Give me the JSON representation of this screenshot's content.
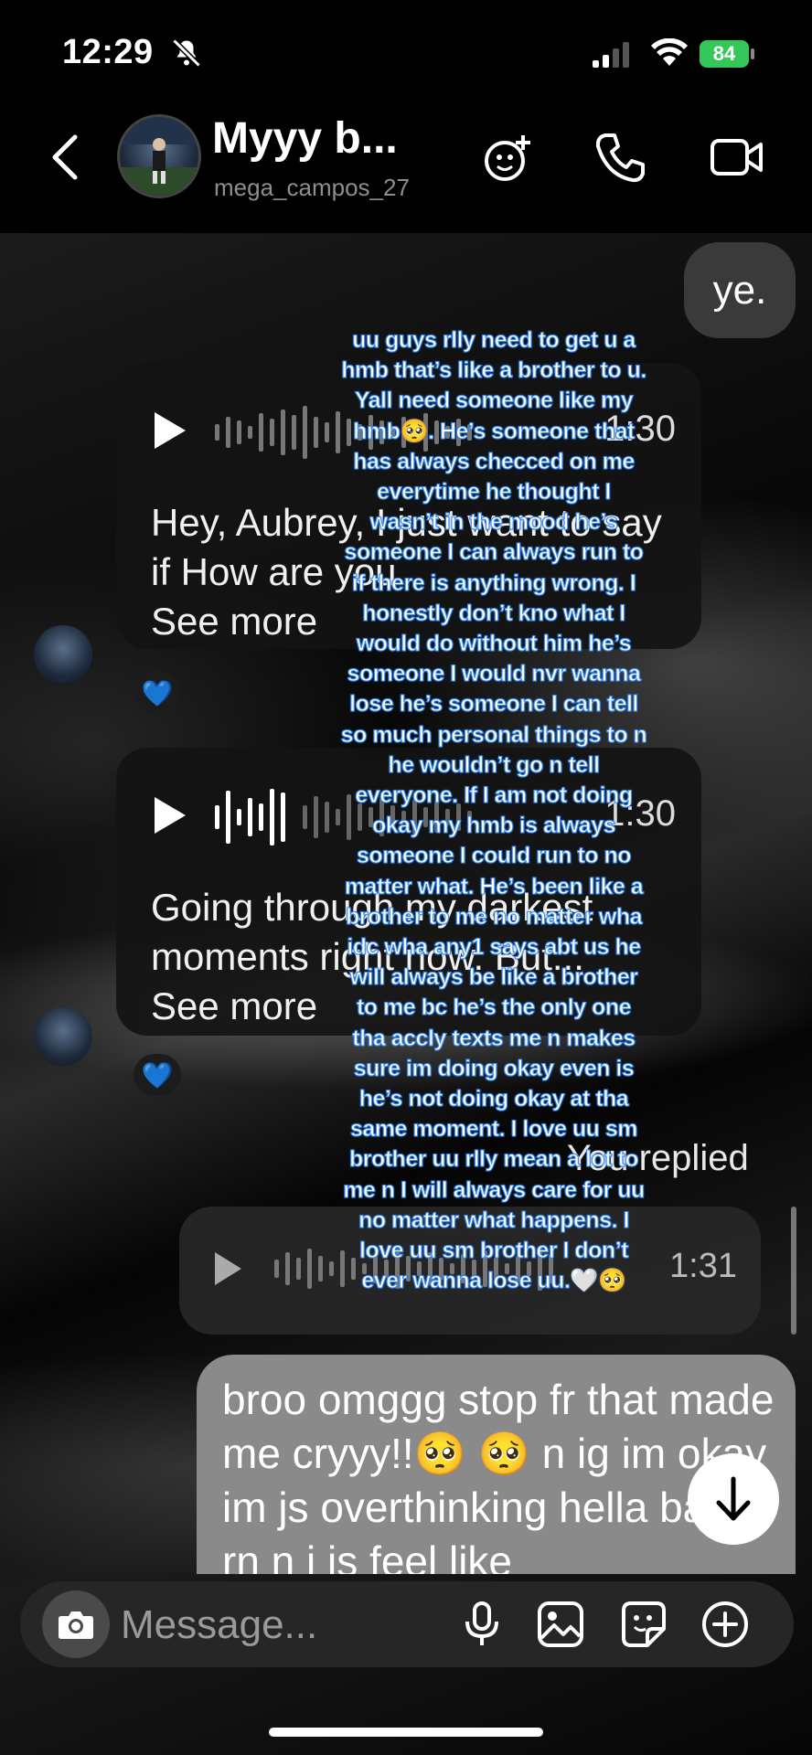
{
  "status_bar": {
    "time": "12:29",
    "battery": "84"
  },
  "header": {
    "title": "Myyy b...",
    "username": "mega_campos_27"
  },
  "messages": {
    "sent_short": "ye.",
    "voice1": {
      "duration": "1:30",
      "transcript": "Hey, Aubrey, I just want to say if How are you",
      "see_more": "See more",
      "reaction": "💙"
    },
    "voice2": {
      "duration": "1:30",
      "transcript": "Going through my darkest moments right now. But...",
      "see_more": "See more",
      "reaction": "💙"
    },
    "you_replied": "You replied",
    "reply_voice_duration": "1:31",
    "reply_text": "broo omggg stop fr that made me cryyy!!🥺 🥺 n ig im okay im js overthinking hella bad rn n i js feel like"
  },
  "composer": {
    "placeholder": "Message..."
  },
  "overlay_caption": "uu guys rlly need to get u a hmb that’s like a brother to u. Yall need someone like my hmb🥺. He’s someone that has always checced on me everytime he thought I wasn’t in the mood he’s someone I can always run to if there is anything wrong. I honestly don’t kno what I would do without him he’s someone I would nvr wanna lose he’s someone I can tell so much personal things to n he wouldn’t go n tell everyone. If I am not doing okay my hmb is always someone I could run to no matter what. He’s been like a brother to me no matter wha idc wha any1 says abt us he will always be like a brother to me bc he’s the only one tha accly texts me n makes sure im doing okay even is he’s not doing okay at tha same moment. I love uu sm brother uu rlly mean a lot to me n I will always care for uu no matter what happens. I love uu sm brother I don’t ever wanna lose uu.🤍🥺",
  "colors": {
    "battery": "#34c759",
    "heart": "#2f6bf3",
    "caption_outline": "#3b8cf0"
  }
}
